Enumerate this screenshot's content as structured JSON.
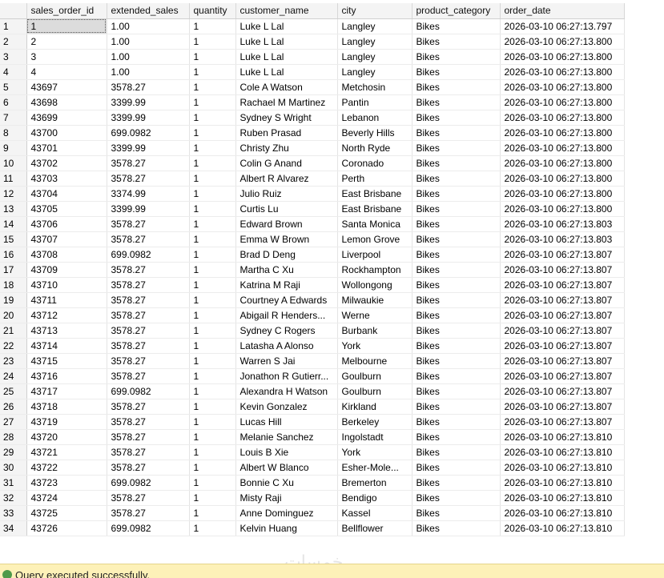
{
  "columns": [
    "",
    "sales_order_id",
    "extended_sales",
    "quantity",
    "customer_name",
    "city",
    "product_category",
    "order_date"
  ],
  "rows": [
    [
      "1",
      "1",
      "1.00",
      "1",
      "Luke L Lal",
      "Langley",
      "Bikes",
      "2026-03-10 06:27:13.797"
    ],
    [
      "2",
      "2",
      "1.00",
      "1",
      "Luke L Lal",
      "Langley",
      "Bikes",
      "2026-03-10 06:27:13.800"
    ],
    [
      "3",
      "3",
      "1.00",
      "1",
      "Luke L Lal",
      "Langley",
      "Bikes",
      "2026-03-10 06:27:13.800"
    ],
    [
      "4",
      "4",
      "1.00",
      "1",
      "Luke L Lal",
      "Langley",
      "Bikes",
      "2026-03-10 06:27:13.800"
    ],
    [
      "5",
      "43697",
      "3578.27",
      "1",
      "Cole A Watson",
      "Metchosin",
      "Bikes",
      "2026-03-10 06:27:13.800"
    ],
    [
      "6",
      "43698",
      "3399.99",
      "1",
      "Rachael M Martinez",
      "Pantin",
      "Bikes",
      "2026-03-10 06:27:13.800"
    ],
    [
      "7",
      "43699",
      "3399.99",
      "1",
      "Sydney S Wright",
      "Lebanon",
      "Bikes",
      "2026-03-10 06:27:13.800"
    ],
    [
      "8",
      "43700",
      "699.0982",
      "1",
      "Ruben  Prasad",
      "Beverly Hills",
      "Bikes",
      "2026-03-10 06:27:13.800"
    ],
    [
      "9",
      "43701",
      "3399.99",
      "1",
      "Christy  Zhu",
      "North Ryde",
      "Bikes",
      "2026-03-10 06:27:13.800"
    ],
    [
      "10",
      "43702",
      "3578.27",
      "1",
      "Colin G Anand",
      "Coronado",
      "Bikes",
      "2026-03-10 06:27:13.800"
    ],
    [
      "11",
      "43703",
      "3578.27",
      "1",
      "Albert R Alvarez",
      "Perth",
      "Bikes",
      "2026-03-10 06:27:13.800"
    ],
    [
      "12",
      "43704",
      "3374.99",
      "1",
      "Julio  Ruiz",
      "East Brisbane",
      "Bikes",
      "2026-03-10 06:27:13.800"
    ],
    [
      "13",
      "43705",
      "3399.99",
      "1",
      "Curtis  Lu",
      "East Brisbane",
      "Bikes",
      "2026-03-10 06:27:13.800"
    ],
    [
      "14",
      "43706",
      "3578.27",
      "1",
      "Edward  Brown",
      "Santa Monica",
      "Bikes",
      "2026-03-10 06:27:13.803"
    ],
    [
      "15",
      "43707",
      "3578.27",
      "1",
      "Emma W Brown",
      "Lemon Grove",
      "Bikes",
      "2026-03-10 06:27:13.803"
    ],
    [
      "16",
      "43708",
      "699.0982",
      "1",
      "Brad D Deng",
      "Liverpool",
      "Bikes",
      "2026-03-10 06:27:13.807"
    ],
    [
      "17",
      "43709",
      "3578.27",
      "1",
      "Martha C Xu",
      "Rockhampton",
      "Bikes",
      "2026-03-10 06:27:13.807"
    ],
    [
      "18",
      "43710",
      "3578.27",
      "1",
      "Katrina M Raji",
      "Wollongong",
      "Bikes",
      "2026-03-10 06:27:13.807"
    ],
    [
      "19",
      "43711",
      "3578.27",
      "1",
      "Courtney A Edwards",
      "Milwaukie",
      "Bikes",
      "2026-03-10 06:27:13.807"
    ],
    [
      "20",
      "43712",
      "3578.27",
      "1",
      "Abigail R Henders...",
      "Werne",
      "Bikes",
      "2026-03-10 06:27:13.807"
    ],
    [
      "21",
      "43713",
      "3578.27",
      "1",
      "Sydney C Rogers",
      "Burbank",
      "Bikes",
      "2026-03-10 06:27:13.807"
    ],
    [
      "22",
      "43714",
      "3578.27",
      "1",
      "Latasha A Alonso",
      "York",
      "Bikes",
      "2026-03-10 06:27:13.807"
    ],
    [
      "23",
      "43715",
      "3578.27",
      "1",
      "Warren S Jai",
      "Melbourne",
      "Bikes",
      "2026-03-10 06:27:13.807"
    ],
    [
      "24",
      "43716",
      "3578.27",
      "1",
      "Jonathon R Gutierr...",
      "Goulburn",
      "Bikes",
      "2026-03-10 06:27:13.807"
    ],
    [
      "25",
      "43717",
      "699.0982",
      "1",
      "Alexandra H Watson",
      "Goulburn",
      "Bikes",
      "2026-03-10 06:27:13.807"
    ],
    [
      "26",
      "43718",
      "3578.27",
      "1",
      "Kevin  Gonzalez",
      "Kirkland",
      "Bikes",
      "2026-03-10 06:27:13.807"
    ],
    [
      "27",
      "43719",
      "3578.27",
      "1",
      "Lucas  Hill",
      "Berkeley",
      "Bikes",
      "2026-03-10 06:27:13.807"
    ],
    [
      "28",
      "43720",
      "3578.27",
      "1",
      "Melanie  Sanchez",
      "Ingolstadt",
      "Bikes",
      "2026-03-10 06:27:13.810"
    ],
    [
      "29",
      "43721",
      "3578.27",
      "1",
      "Louis B Xie",
      "York",
      "Bikes",
      "2026-03-10 06:27:13.810"
    ],
    [
      "30",
      "43722",
      "3578.27",
      "1",
      "Albert W Blanco",
      "Esher-Mole...",
      "Bikes",
      "2026-03-10 06:27:13.810"
    ],
    [
      "31",
      "43723",
      "699.0982",
      "1",
      "Bonnie C Xu",
      "Bremerton",
      "Bikes",
      "2026-03-10 06:27:13.810"
    ],
    [
      "32",
      "43724",
      "3578.27",
      "1",
      "Misty  Raji",
      "Bendigo",
      "Bikes",
      "2026-03-10 06:27:13.810"
    ],
    [
      "33",
      "43725",
      "3578.27",
      "1",
      "Anne  Dominguez",
      "Kassel",
      "Bikes",
      "2026-03-10 06:27:13.810"
    ],
    [
      "34",
      "43726",
      "699.0982",
      "1",
      "Kelvin  Huang",
      "Bellflower",
      "Bikes",
      "2026-03-10 06:27:13.810"
    ]
  ],
  "status": {
    "text": "Query executed successfully.",
    "icon": "success-check-icon",
    "color": "#4f9a4a"
  },
  "watermark": "خمسات"
}
